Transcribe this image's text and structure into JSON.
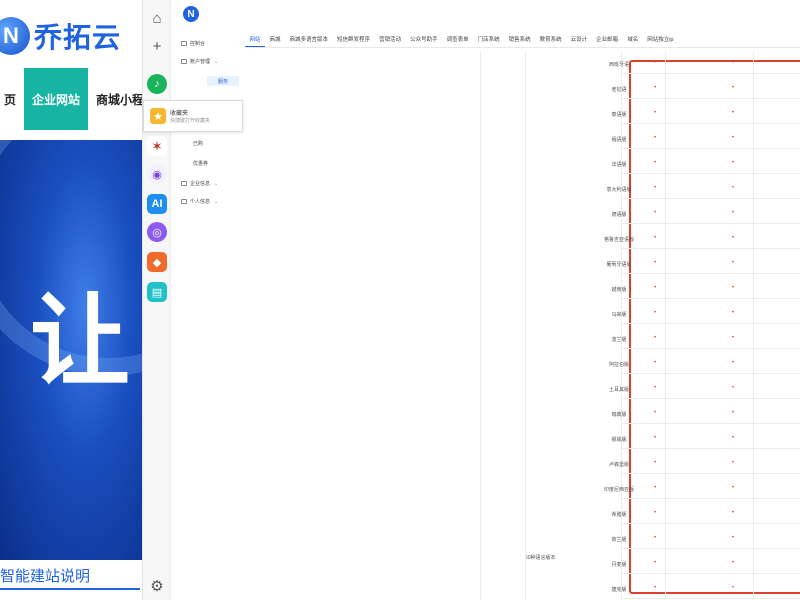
{
  "background_site": {
    "logo_text": "乔拓云",
    "nav": [
      "页",
      "企业网站",
      "商城小程序"
    ],
    "hero_char": "让",
    "footer_link": "智能建站说明"
  },
  "favorites_popup": {
    "title": "收藏夹",
    "hint": "快捷键打开收藏夹"
  },
  "sidebar_menu": {
    "items": [
      {
        "label": "控制台",
        "caret": false
      },
      {
        "label": "账户管理",
        "caret": true
      },
      {
        "label": "已购",
        "caret": false
      },
      {
        "label": "优惠券",
        "caret": false
      },
      {
        "label": "企业信息",
        "caret": true
      },
      {
        "label": "个人信息",
        "caret": true
      }
    ],
    "active_subitem": "服务"
  },
  "tabs": [
    "网站",
    "商城",
    "商城多语言版本",
    "短信群发程序",
    "营销活动",
    "公众号助手",
    "调查表单",
    "门店系统",
    "销售系统",
    "教育系统",
    "云设计",
    "企业邮箱",
    "域名",
    "网站独立ip"
  ],
  "active_tab_index": 0,
  "language_table": {
    "group_label": "50种语言版本",
    "languages": [
      "西班牙语",
      "老挝语",
      "泰语版",
      "缅语版",
      "法语版",
      "意大利语版",
      "德语版",
      "格鲁吉亚语版",
      "葡萄牙语版",
      "越南版",
      "马来版",
      "波兰版",
      "阿拉伯版",
      "土耳其版",
      "瑞典版",
      "挪威版",
      "卢森堡版",
      "印度尼西亚版",
      "希腊版",
      "荷兰版",
      "丹麦版",
      "捷克版"
    ],
    "mark": "•"
  }
}
